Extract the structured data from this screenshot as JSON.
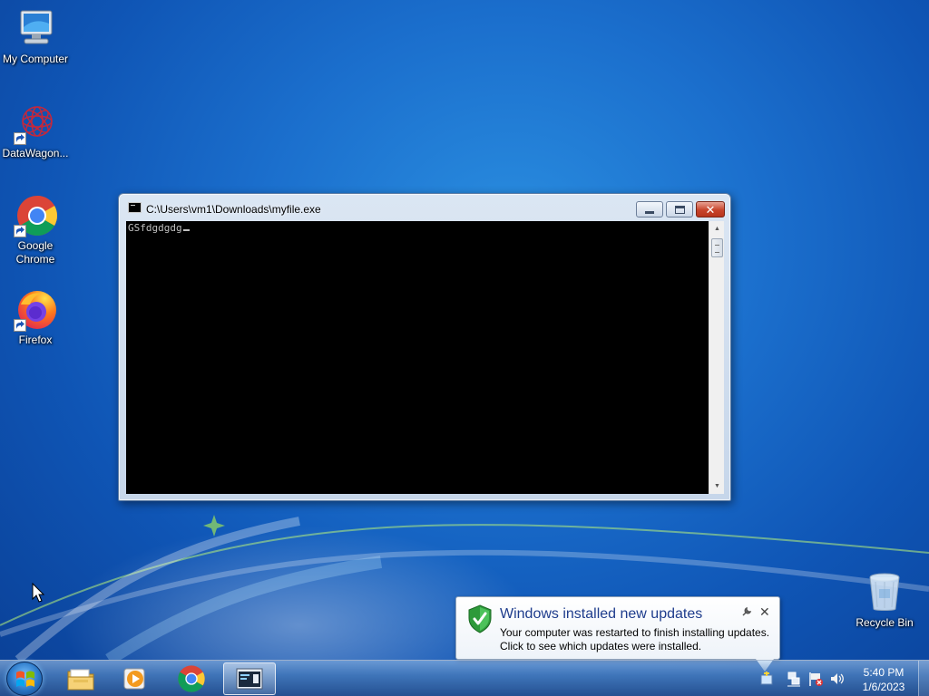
{
  "desktop": {
    "icons": [
      {
        "label": "My Computer",
        "icon": "computer-icon"
      },
      {
        "label": "DataWagon...",
        "icon": "datawagon-icon"
      },
      {
        "label": "Google Chrome",
        "icon": "chrome-icon"
      },
      {
        "label": "Firefox",
        "icon": "firefox-icon"
      },
      {
        "label": "Recycle Bin",
        "icon": "recycle-bin-icon"
      }
    ]
  },
  "console_window": {
    "title": "C:\\Users\\vm1\\Downloads\\myfile.exe",
    "output_text": "GSfdgdgdg",
    "buttons": {
      "minimize": "minimize-icon",
      "maximize": "maximize-icon",
      "close": "close-icon"
    }
  },
  "notification": {
    "title": "Windows installed new updates",
    "line1": "Your computer was restarted to finish installing updates.",
    "line2": "Click to see which updates were installed.",
    "icon": "shield-check-icon"
  },
  "taskbar": {
    "pinned": [
      {
        "name": "windows-explorer",
        "icon": "folder-icon"
      },
      {
        "name": "media-player",
        "icon": "media-player-icon"
      },
      {
        "name": "chrome",
        "icon": "chrome-icon"
      },
      {
        "name": "console",
        "icon": "console-window-icon",
        "active": true
      }
    ],
    "tray": [
      "action-center-icon",
      "network-icon",
      "flag-icon",
      "volume-icon"
    ],
    "clock": {
      "time": "5:40 PM",
      "date": "1/6/2023"
    }
  }
}
